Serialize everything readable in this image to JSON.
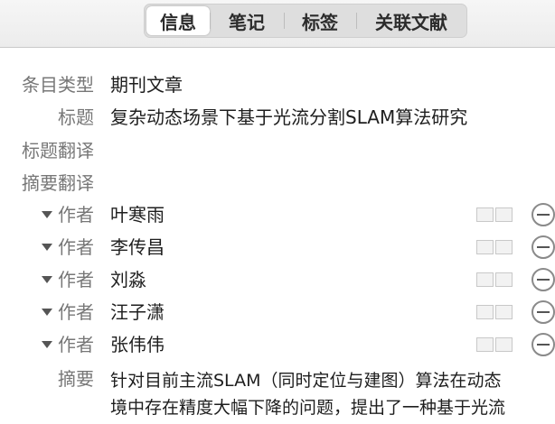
{
  "tabs": [
    {
      "label": "信息",
      "active": true
    },
    {
      "label": "笔记"
    },
    {
      "label": "标签"
    },
    {
      "label": "关联文献"
    }
  ],
  "fields": {
    "item_type": {
      "label": "条目类型",
      "value": "期刊文章"
    },
    "title": {
      "label": "标题",
      "value": "复杂动态场景下基于光流分割SLAM算法研究"
    },
    "title_translation": {
      "label": "标题翻译",
      "value": ""
    },
    "abstract_translation": {
      "label": "摘要翻译",
      "value": ""
    }
  },
  "creators": [
    {
      "role": "作者",
      "name": "叶寒雨"
    },
    {
      "role": "作者",
      "name": "李传昌"
    },
    {
      "role": "作者",
      "name": "刘淼"
    },
    {
      "role": "作者",
      "name": "汪子潇"
    },
    {
      "role": "作者",
      "name": "张伟伟"
    }
  ],
  "abstract": {
    "label": "摘要",
    "line1": "针对目前主流SLAM（同时定位与建图）算法在动态",
    "line2": "境中存在精度大幅下降的问题，提出了一种基于光流"
  }
}
